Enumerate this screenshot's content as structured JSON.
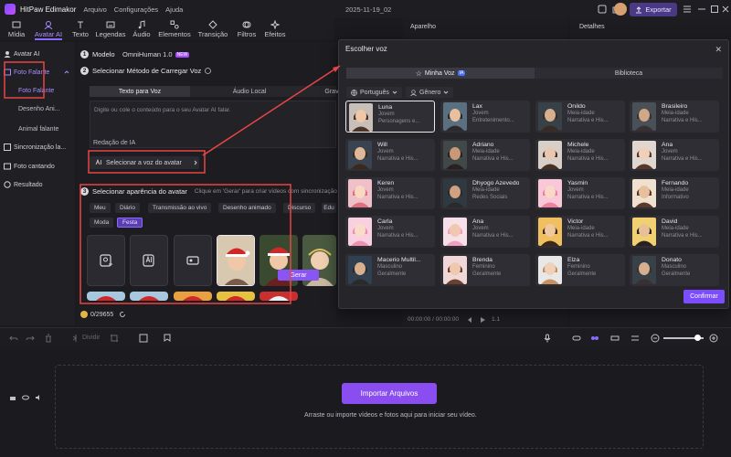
{
  "app": {
    "name": "HitPaw Edimakor",
    "menu": [
      "Arquivo",
      "Configurações",
      "Ajuda"
    ],
    "project_name": "2025-11-19_02",
    "export_label": "Exportar"
  },
  "toolbar": {
    "items": [
      {
        "label": "Mídia",
        "icon": "media-icon"
      },
      {
        "label": "Avatar AI",
        "icon": "avatar-ai-icon",
        "active": true
      },
      {
        "label": "Texto",
        "icon": "text-icon"
      },
      {
        "label": "Legendas",
        "icon": "subtitles-icon"
      },
      {
        "label": "Áudio",
        "icon": "audio-icon"
      },
      {
        "label": "Elementos",
        "icon": "elements-icon"
      },
      {
        "label": "Transição",
        "icon": "transition-icon"
      },
      {
        "label": "Filtros",
        "icon": "filters-icon"
      },
      {
        "label": "Efeitos",
        "icon": "effects-icon"
      }
    ]
  },
  "sidebar": {
    "avatar_ai": "Avatar AI",
    "foto_falante": "Foto Falante",
    "sub_items": [
      "Foto Falante",
      "Desenho Ani...",
      "Animal falante"
    ],
    "sync": "Sincronização la...",
    "singing": "Foto cantando",
    "result": "Resultado"
  },
  "center": {
    "step1_label": "Modelo",
    "model_value": "OmniHuman 1.0",
    "new_badge": "NEW",
    "step2_label": "Selecionar Método de Carregar Voz",
    "tabs": [
      "Texto para Voz",
      "Áudio Local",
      "Grav"
    ],
    "textarea_placeholder": "Digite ou cole o conteúdo para o seu Avatar AI falar.",
    "ai_edit_label": "Redação de IA",
    "select_voice_label": "Selecionar a voz do avatar",
    "step3_label": "Selecionar aparência do avatar",
    "step3_hint": "Clique em 'Gerar' para criar vídeos com sincronização",
    "categories": [
      "Meu",
      "Diário",
      "Transmissão ao vivo",
      "Desenho animado",
      "Discurso",
      "Edu",
      "Moda",
      "Festa"
    ],
    "active_category": "Festa",
    "credits": "0/29655",
    "generate_label": "Gerar"
  },
  "preview": {
    "tab_label": "Aparelho",
    "time": "00:00:00 / 00:00:00",
    "speed": "1.1"
  },
  "details": {
    "tab_label": "Detalhes"
  },
  "modal": {
    "title": "Escolher voz",
    "tab_my_voice": "Minha Voz",
    "ia_badge": "IA",
    "tab_library": "Biblioteca",
    "language": "Português",
    "gender": "Gênero",
    "voices": [
      {
        "name": "Luna",
        "line1": "Jovem",
        "line2": "Personagens e...",
        "selected": true,
        "skin": "#f0c8a8",
        "hair": "#4a3528",
        "bg": "#c8c0b8"
      },
      {
        "name": "Lax",
        "line1": "Jovem",
        "line2": "Entretenimento...",
        "skin": "#e8c0a0",
        "hair": "#2a2a2a",
        "bg": "#5a7080"
      },
      {
        "name": "Onildo",
        "line1": "Meia-idade",
        "line2": "Narrativa e His...",
        "skin": "#d8b090",
        "hair": "#3a2a20",
        "bg": "#384048"
      },
      {
        "name": "Brasileiro",
        "line1": "Meia-idade",
        "line2": "Narrativa e His...",
        "skin": "#d0a888",
        "hair": "#3a3030",
        "bg": "#4a5058"
      },
      {
        "name": "Will",
        "line1": "Jovem",
        "line2": "Narrativa e His...",
        "skin": "#e0b898",
        "hair": "#3a2818",
        "bg": "#3a4450"
      },
      {
        "name": "Adriano",
        "line1": "Meia-idade",
        "line2": "Narrativa e His...",
        "skin": "#c89878",
        "hair": "#2a2020",
        "bg": "#404848"
      },
      {
        "name": "Michele",
        "line1": "Meia-idade",
        "line2": "Narrativa e His...",
        "skin": "#e8c8b0",
        "hair": "#4a3020",
        "bg": "#d8d0c8"
      },
      {
        "name": "Ana",
        "line1": "Jovem",
        "line2": "Narrativa e His...",
        "skin": "#f0d0b8",
        "hair": "#5a3828",
        "bg": "#e0d8d0"
      },
      {
        "name": "Keren",
        "line1": "Jovem",
        "line2": "Narrativa e His...",
        "skin": "#f8d8c0",
        "hair": "#e07080",
        "bg": "#f0c0c8"
      },
      {
        "name": "Dhyogo Azevedo",
        "line1": "Meia-idade",
        "line2": "Redes Sociais",
        "skin": "#d0a080",
        "hair": "#2a2a2a",
        "bg": "#303840"
      },
      {
        "name": "Yasmin",
        "line1": "Jovem",
        "line2": "Narrativa e His...",
        "skin": "#f8d8c8",
        "hair": "#f080a0",
        "bg": "#f8c8d8"
      },
      {
        "name": "Fernando",
        "line1": "Meia-idade",
        "line2": "Informativo",
        "skin": "#e8c0a0",
        "hair": "#5a3a28",
        "bg": "#f0e0d0"
      },
      {
        "name": "Carla",
        "line1": "Jovem",
        "line2": "Narrativa e His...",
        "skin": "#f8dcc8",
        "hair": "#f090b0",
        "bg": "#f8d0e0"
      },
      {
        "name": "Ana",
        "line1": "Jovem",
        "line2": "Narrativa e His...",
        "skin": "#f0c8b0",
        "hair": "#f0a0c0",
        "bg": "#f8e0e8"
      },
      {
        "name": "Victor",
        "line1": "Meia-idade",
        "line2": "Narrativa e His...",
        "skin": "#f0c8a0",
        "hair": "#3a2818",
        "bg": "#f0c060"
      },
      {
        "name": "David",
        "line1": "Meia-idade",
        "line2": "Narrativa e His...",
        "skin": "#e8c098",
        "hair": "#2a2020",
        "bg": "#f0d070"
      },
      {
        "name": "Macerio Multil...",
        "line1": "Masculino",
        "line2": "Geralmente",
        "skin": "#d8b090",
        "hair": "#2a2a2a",
        "bg": "#304050"
      },
      {
        "name": "Brenda",
        "line1": "Feminino",
        "line2": "Geralmente",
        "skin": "#f0c8b0",
        "hair": "#6a4030",
        "bg": "#f0d8d8"
      },
      {
        "name": "Elza",
        "line1": "Feminino",
        "line2": "Geralmente",
        "skin": "#f0d0b8",
        "hair": "#c89060",
        "bg": "#e8e8e8"
      },
      {
        "name": "Donato",
        "line1": "Masculino",
        "line2": "Geralmente",
        "skin": "#d8b090",
        "hair": "#3a3030",
        "bg": "#384048"
      }
    ],
    "confirm_label": "Confirmar"
  },
  "timeline": {
    "divide_label": "Dividir",
    "import_label": "Importar Arquivos",
    "drop_hint": "Arraste ou importe vídeos e fotos aqui para iniciar seu vídeo."
  },
  "colors": {
    "accent": "#8a55f5",
    "annotation": "#e84545"
  }
}
